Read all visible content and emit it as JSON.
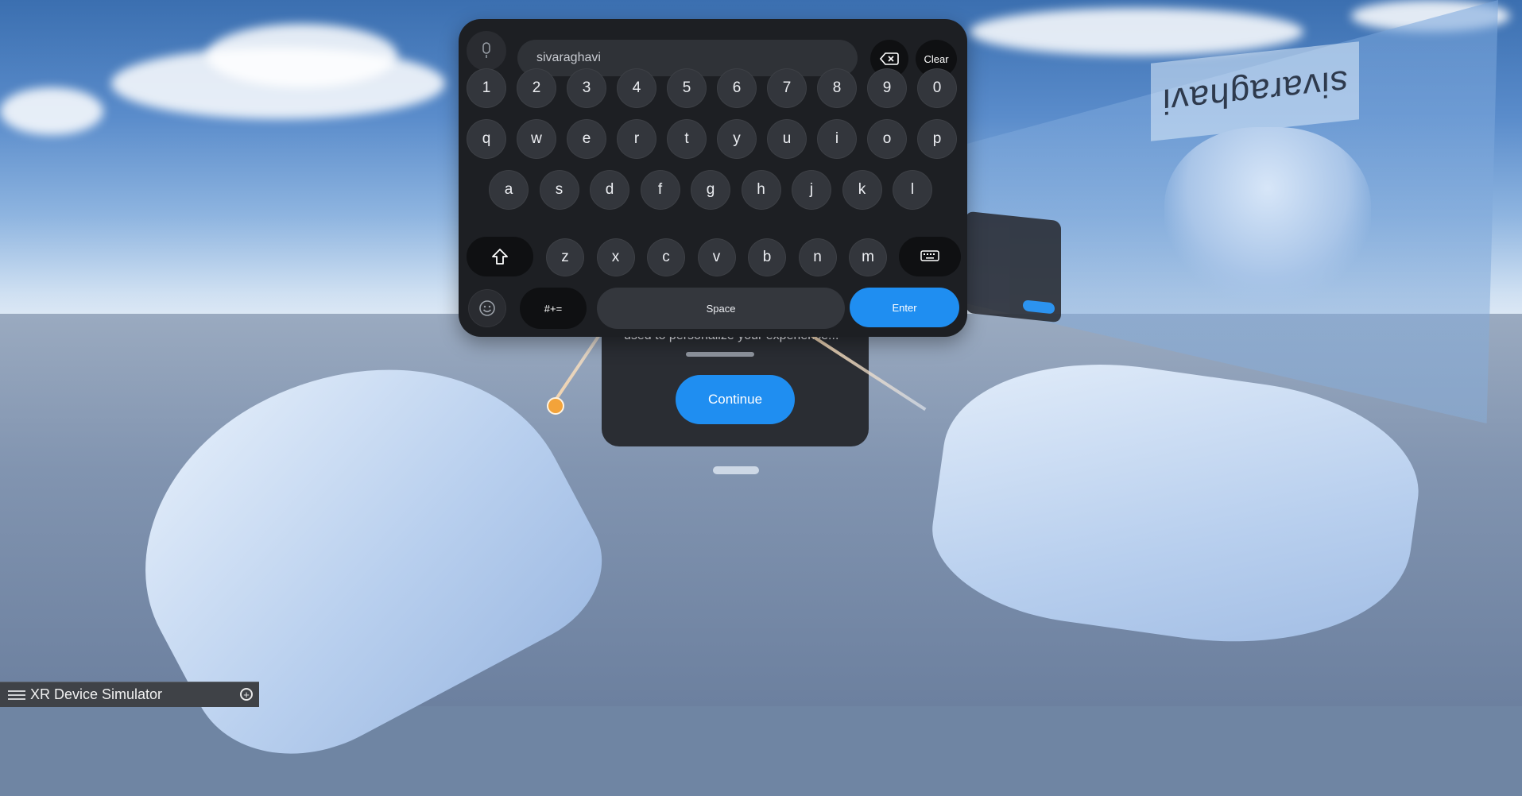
{
  "colors": {
    "accent": "#1f8ef1",
    "keyboard_bg": "#1d1f23",
    "key_bg": "#33363c"
  },
  "scene": {
    "mirrored_text": "sivaraghavi"
  },
  "dialog": {
    "description": "used to personalize your experience...",
    "continue_label": "Continue"
  },
  "keyboard": {
    "input_value": "sivaraghavi",
    "mic_icon": "microphone-icon",
    "backspace_icon": "backspace-icon",
    "clear_label": "Clear",
    "number_row": [
      "1",
      "2",
      "3",
      "4",
      "5",
      "6",
      "7",
      "8",
      "9",
      "0"
    ],
    "row1": [
      "q",
      "w",
      "e",
      "r",
      "t",
      "y",
      "u",
      "i",
      "o",
      "p"
    ],
    "row2": [
      "a",
      "s",
      "d",
      "f",
      "g",
      "h",
      "j",
      "k",
      "l"
    ],
    "row3": [
      "z",
      "x",
      "c",
      "v",
      "b",
      "n",
      "m"
    ],
    "shift_icon": "shift-arrow-icon",
    "hide_keyboard_icon": "keyboard-icon",
    "emoji_icon": "emoji-icon",
    "symbols_label": "#+=",
    "space_label": "Space",
    "enter_label": "Enter"
  },
  "simulator": {
    "title": "XR Device Simulator",
    "menu_icon": "grip-icon",
    "expand_icon": "plus-circle-icon"
  }
}
